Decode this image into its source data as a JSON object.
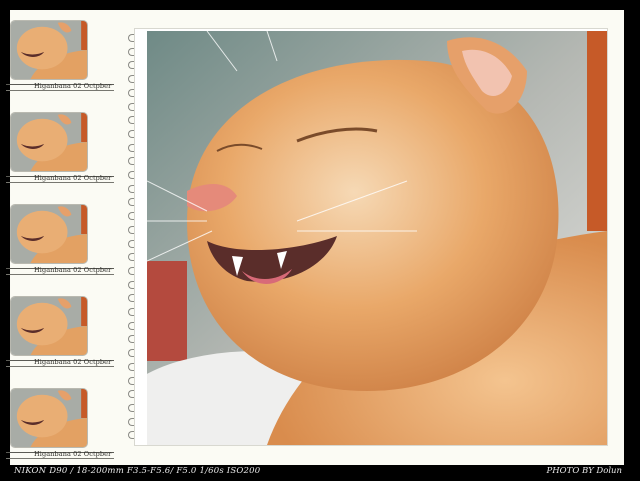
{
  "thumbnails": [
    {
      "caption": "Higanbana 02 Octpber"
    },
    {
      "caption": "Higanbana 02 Octpber"
    },
    {
      "caption": "Higanbana 02 Octpber"
    },
    {
      "caption": "Higanbana 02 Octpber"
    },
    {
      "caption": "Higanbana 02 Octpber"
    }
  ],
  "footer": {
    "camera_info": "NIKON D90 / 18-200mm  F3.5-F5.6/ F5.0 1/60s ISO200",
    "credit": "PHOTO BY Dolun"
  },
  "colors": {
    "background": "#000000",
    "paper": "#fbfbf4",
    "cat_fur": "#e9a869",
    "photo_bg": "#9fa39e"
  },
  "icons": {
    "binder_rings": "binder-ring-icon"
  }
}
